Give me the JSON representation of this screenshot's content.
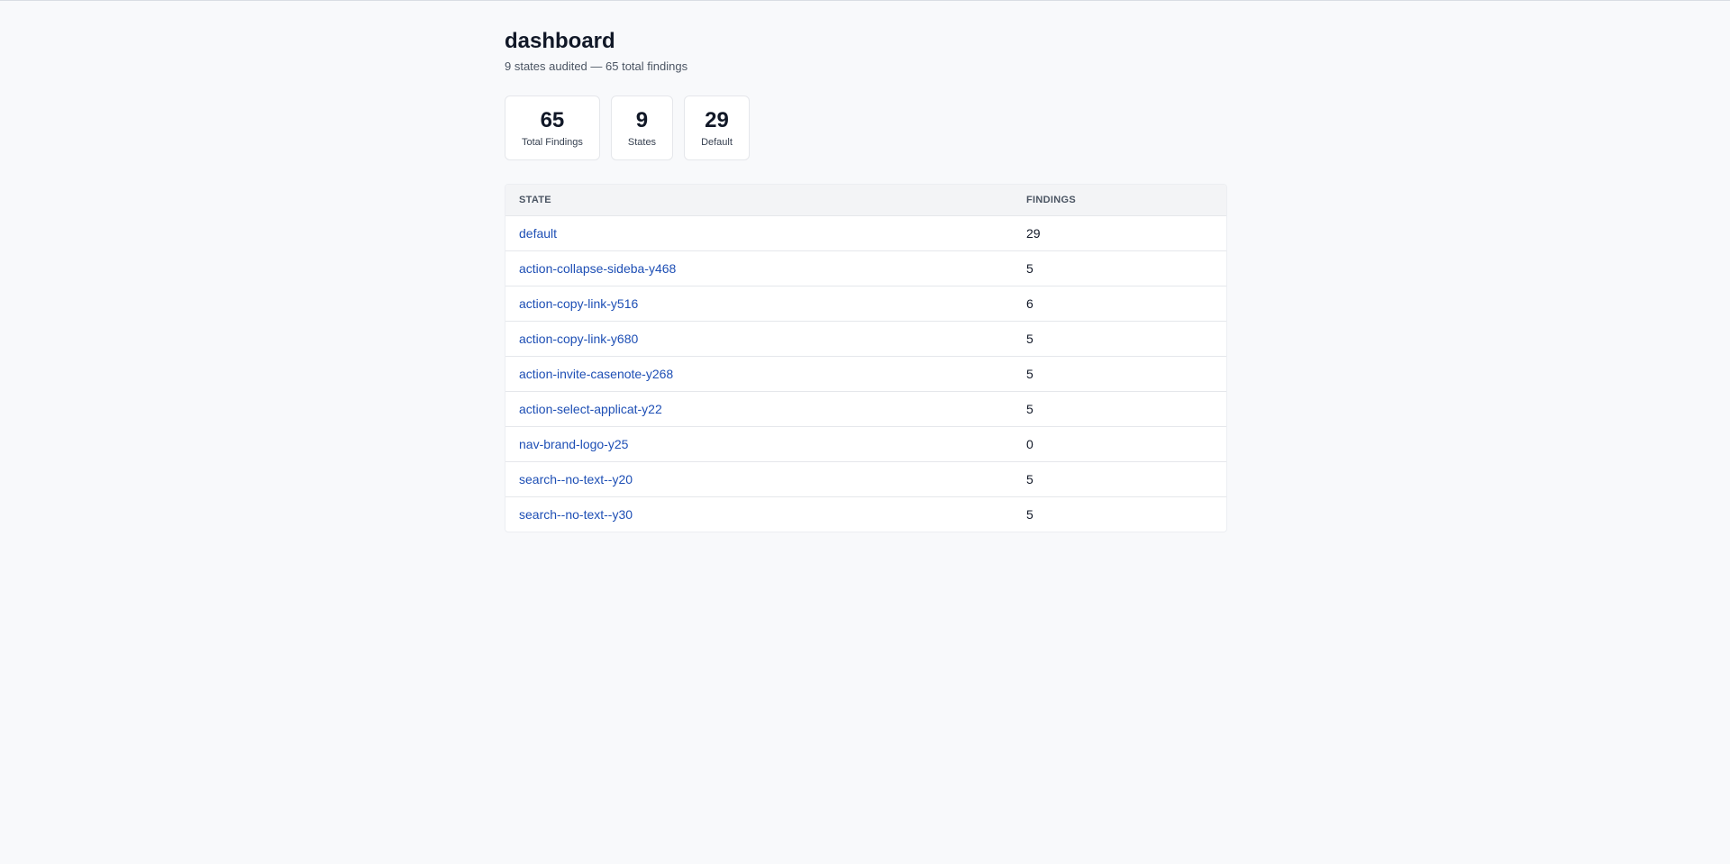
{
  "page": {
    "title": "dashboard",
    "subtitle": "9 states audited — 65 total findings"
  },
  "stats": [
    {
      "value": "65",
      "label": "Total Findings"
    },
    {
      "value": "9",
      "label": "States"
    },
    {
      "value": "29",
      "label": "Default"
    }
  ],
  "table": {
    "headers": {
      "state": "STATE",
      "findings": "FINDINGS"
    },
    "rows": [
      {
        "state": "default",
        "findings": "29"
      },
      {
        "state": "action-collapse-sideba-y468",
        "findings": "5"
      },
      {
        "state": "action-copy-link-y516",
        "findings": "6"
      },
      {
        "state": "action-copy-link-y680",
        "findings": "5"
      },
      {
        "state": "action-invite-casenote-y268",
        "findings": "5"
      },
      {
        "state": "action-select-applicat-y22",
        "findings": "5"
      },
      {
        "state": "nav-brand-logo-y25",
        "findings": "0"
      },
      {
        "state": "search--no-text--y20",
        "findings": "5"
      },
      {
        "state": "search--no-text--y30",
        "findings": "5"
      }
    ]
  },
  "colors": {
    "background": "#f8f9fb",
    "link": "#1e4fb5",
    "text": "#111827"
  }
}
